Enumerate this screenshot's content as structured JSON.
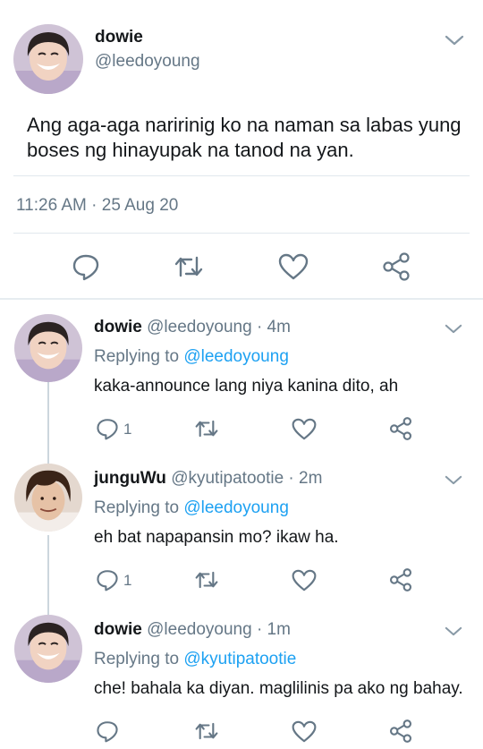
{
  "main_tweet": {
    "name": "dowie",
    "handle": "@leedoyoung",
    "text": "Ang aga-aga naririnig ko na naman sa labas yung boses ng hinayupak na tanod na yan.",
    "timestamp": "11:26 AM · 25 Aug 20",
    "actions": [
      "reply-icon",
      "retweet-icon",
      "like-icon",
      "share-icon"
    ]
  },
  "replies": [
    {
      "name": "dowie",
      "handle": "@leedoyoung",
      "time": " · 4m",
      "replying_prefix": "Replying to ",
      "replying_to": "@leedoyoung",
      "text": "kaka-announce lang niya kanina dito, ah",
      "reply_count": "1"
    },
    {
      "name": "junguWu",
      "handle": "@kyutipatootie",
      "time": " · 2m",
      "replying_prefix": "Replying to ",
      "replying_to": "@leedoyoung",
      "text": "eh bat napapansin mo? ikaw ha.",
      "reply_count": "1"
    },
    {
      "name": "dowie",
      "handle": "@leedoyoung",
      "time": " · 1m",
      "replying_prefix": "Replying to ",
      "replying_to": "@kyutipatootie",
      "text": "che! bahala ka diyan. maglilinis pa ako ng bahay.",
      "reply_count": ""
    }
  ],
  "colors": {
    "text": "#14171a",
    "secondary": "#657786",
    "link": "#1da1f2",
    "icon": "#657786",
    "divider": "#e1e8ed"
  }
}
